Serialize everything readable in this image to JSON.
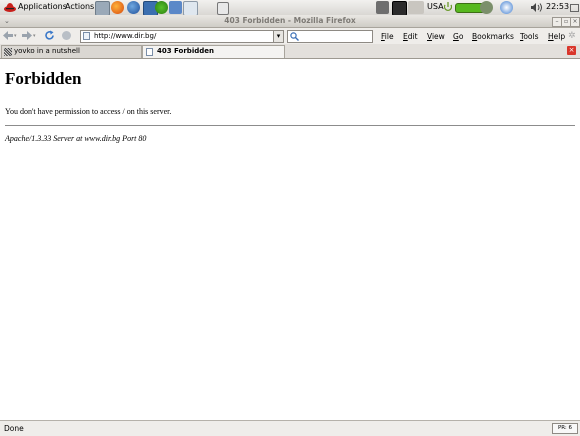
{
  "panel": {
    "applications_label": "Applications",
    "actions_label": "Actions",
    "keyboard_layout": "USA",
    "clock": "22:53"
  },
  "window": {
    "title": "403 Forbidden - Mozilla Firefox",
    "minimize": "–",
    "maximize": "▫",
    "close": "×"
  },
  "navbar": {
    "url": "http://www.dir.bg/",
    "menu": [
      "File",
      "Edit",
      "View",
      "Go",
      "Bookmarks",
      "Tools",
      "Help"
    ]
  },
  "tabs": [
    {
      "label": "yovko in a nutshell",
      "active": false
    },
    {
      "label": "403 Forbidden",
      "active": true
    }
  ],
  "page": {
    "heading": "Forbidden",
    "message": "You don't have permission to access / on this server.",
    "address": "Apache/1.3.33 Server at www.dir.bg Port 80"
  },
  "status": {
    "text": "Done",
    "badge": "PR: 6"
  },
  "colors": {
    "panel_bg": "#d9d7d3",
    "close_tab_red": "#d9362b"
  },
  "icons": [
    "redhat-icon",
    "terminal-icon",
    "firefox-icon",
    "thunderbird-icon",
    "monitor-icon",
    "gnome-icon",
    "edit-icon",
    "document-icon",
    "printer-icon",
    "camera-icon",
    "battery-icon",
    "network-icon",
    "weather-icon",
    "volume-icon",
    "back-icon",
    "forward-icon",
    "reload-icon",
    "stop-icon",
    "page-icon",
    "search-icon"
  ]
}
